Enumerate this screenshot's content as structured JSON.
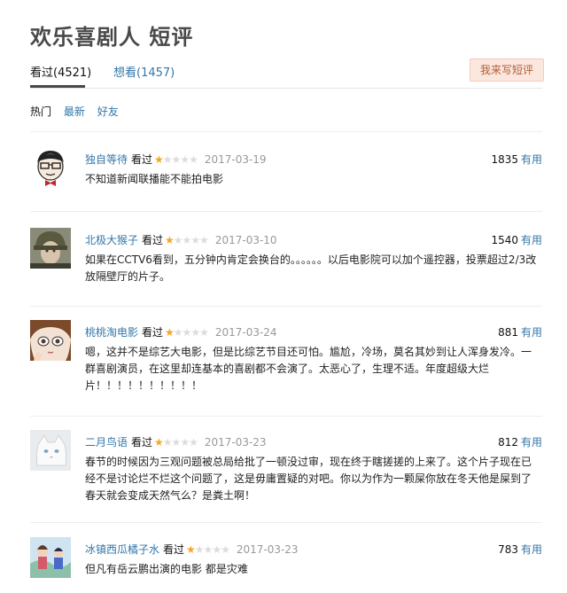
{
  "title": "欢乐喜剧人 短评",
  "tabs": [
    {
      "label": "看过(4521)"
    },
    {
      "label": "想看(1457)"
    }
  ],
  "write_button": "我来写短评",
  "sort_options": [
    "热门",
    "最新",
    "好友"
  ],
  "useful_label": "有用",
  "colors": {
    "link": "#3377aa",
    "star": "#f5a623",
    "button_bg": "#fbe7dd"
  },
  "reviews": [
    {
      "author": "独自等待",
      "status": "看过",
      "rating": 1,
      "date": "2017-03-19",
      "votes": "1835",
      "content": "不知道新闻联播能不能拍电影",
      "avatar": "cartoon-avatar"
    },
    {
      "author": "北极大猴子",
      "status": "看过",
      "rating": 1,
      "date": "2017-03-10",
      "votes": "1540",
      "content": "如果在CCTV6看到，五分钟内肯定会换台的。。。。。。以后电影院可以加个遥控器，投票超过2/3改放隔壁厅的片子。",
      "avatar": "photo-avatar"
    },
    {
      "author": "桃桃淘电影",
      "status": "看过",
      "rating": 1,
      "date": "2017-03-24",
      "votes": "881",
      "content": "嗯，这并不是综艺大电影，但是比综艺节目还可怕。尴尬，冷场，莫名其妙到让人浑身发冷。一群喜剧演员，在这里却连基本的喜剧都不会演了。太恶心了，生理不适。年度超级大烂片！！！！！！！！！！",
      "avatar": "anime-avatar"
    },
    {
      "author": "二月鸟语",
      "status": "看过",
      "rating": 1,
      "date": "2017-03-23",
      "votes": "812",
      "content": "春节的时候因为三观问题被总局给批了一顿没过审，现在终于瞎搓搓的上来了。这个片子现在已经不是讨论烂不烂这个问题了，这是毋庸置疑的对吧。你以为作为一颗屎你放在冬天他是屎到了春天就会变成天然气么？是粪土啊！",
      "avatar": "cat-avatar"
    },
    {
      "author": "冰镇西瓜橘子水",
      "status": "看过",
      "rating": 1,
      "date": "2017-03-23",
      "votes": "783",
      "content": "但凡有岳云鹏出演的电影 都是灾难",
      "avatar": "illustration-avatar"
    }
  ]
}
